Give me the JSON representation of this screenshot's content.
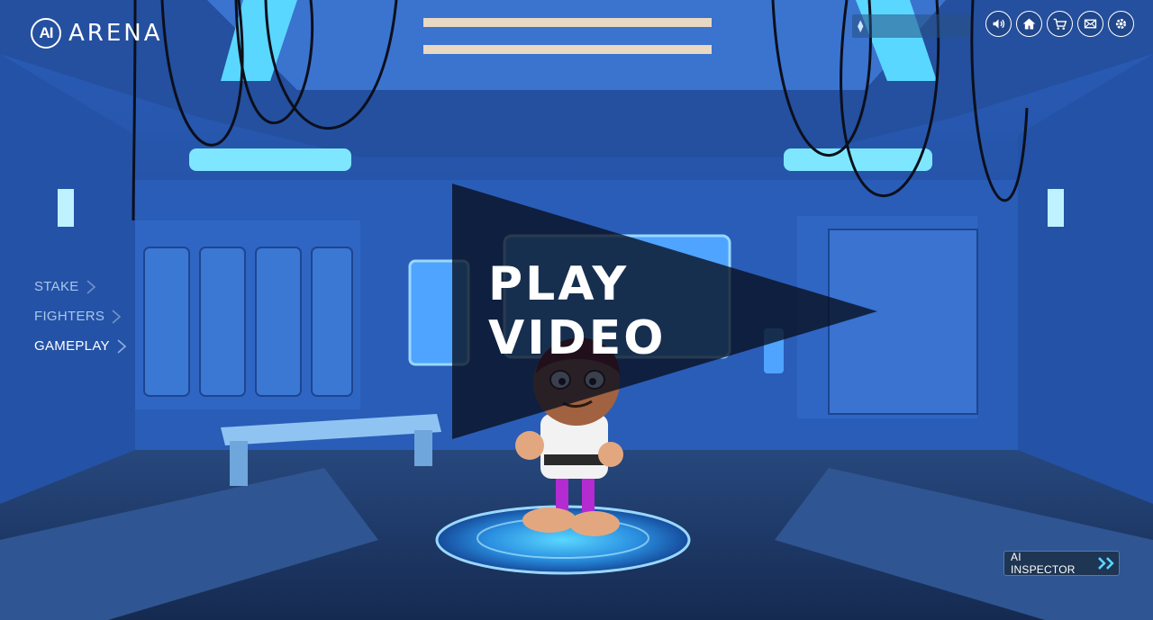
{
  "logo": {
    "badge": "AI",
    "word": "ARENA"
  },
  "wallet": {
    "currency_icon": "ethereum-icon",
    "symbol": "⧫",
    "balance": ""
  },
  "toolbar": [
    {
      "name": "sound-icon"
    },
    {
      "name": "home-icon"
    },
    {
      "name": "cart-icon"
    },
    {
      "name": "mail-icon"
    },
    {
      "name": "gear-icon"
    }
  ],
  "menu": {
    "items": [
      {
        "label": "STAKE",
        "active": false
      },
      {
        "label": "FIGHTERS",
        "active": false
      },
      {
        "label": "GAMEPLAY",
        "active": true
      }
    ]
  },
  "video": {
    "line1": "PLAY",
    "line2": "VIDEO"
  },
  "inspector": {
    "label": "AI INSPECTOR"
  },
  "colors": {
    "accent": "#5ad7ff",
    "room": "#2f6bc7",
    "floor": "#1a2e55"
  }
}
